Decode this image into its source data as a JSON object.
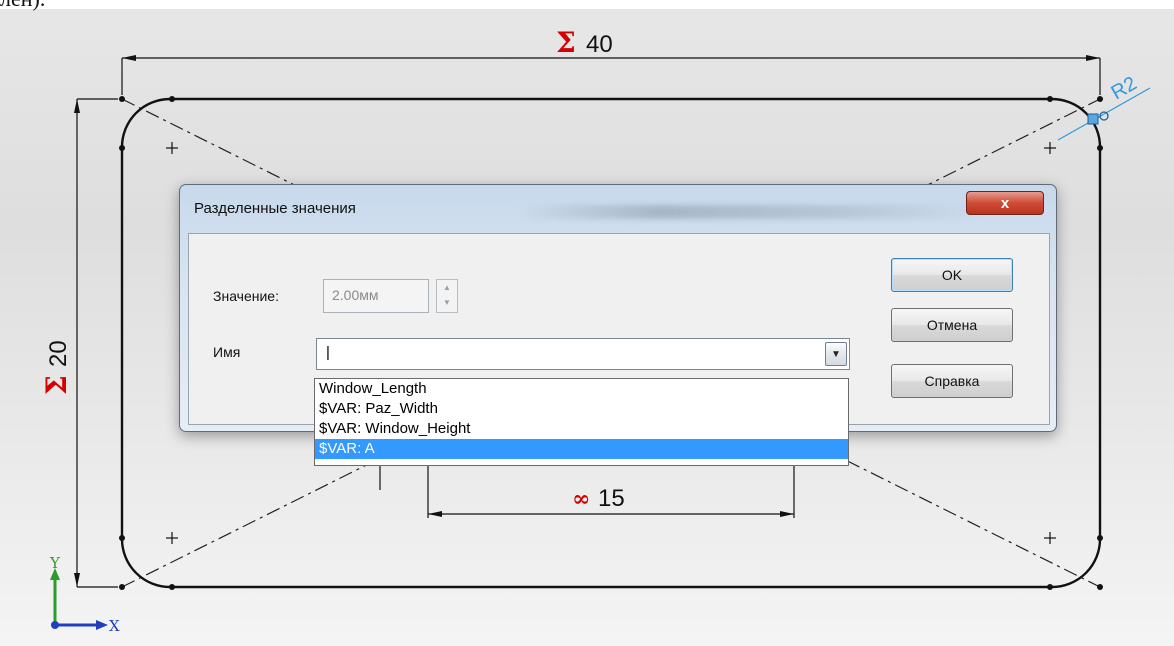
{
  "page_fragment": "лен).",
  "sketch": {
    "dim_width_value": "40",
    "dim_height_value": "20",
    "dim_bottom_value": "15",
    "radius_label": "R2",
    "axis_y": "Y",
    "axis_x": "X",
    "colors": {
      "line": "#111111",
      "symbol": "#d40000",
      "radius": "#3399dd",
      "axis_y": "#2a9d2a",
      "axis_x": "#1f3fbf"
    }
  },
  "dialog": {
    "title": "Разделенные значения",
    "close_label": "x",
    "value_label": "Значение:",
    "value": "2.00мм",
    "name_label": "Имя",
    "name_value": "|",
    "ok_label": "OK",
    "cancel_label": "Отмена",
    "help_label": "Справка"
  },
  "dropdown": {
    "items": [
      "Window_Length",
      "$VAR: Paz_Width",
      "$VAR: Window_Height",
      "$VAR: A"
    ],
    "selected_index": 3
  }
}
